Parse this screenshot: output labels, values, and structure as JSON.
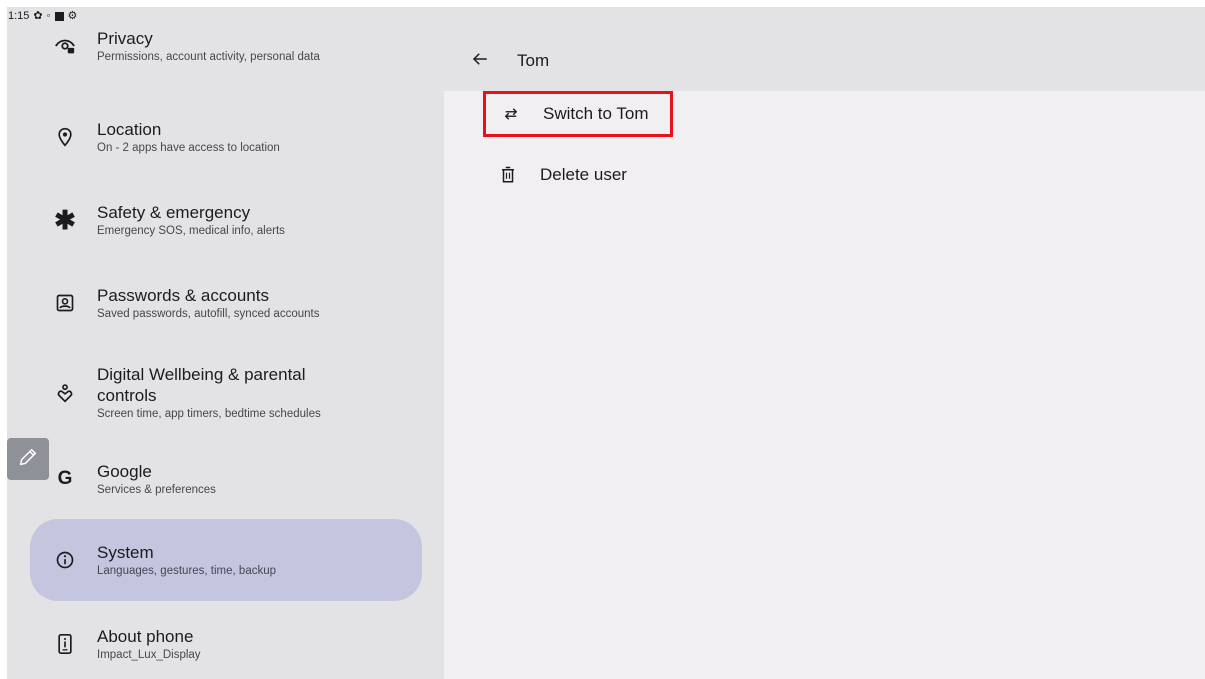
{
  "status_bar": {
    "time": "1:15",
    "icons": [
      "settings-gear-icon",
      "dot-icon",
      "square-icon",
      "android-icon"
    ],
    "right_indicator": "‹·›"
  },
  "settings_menu": {
    "items": [
      {
        "title": "Privacy",
        "subtitle": "Permissions, account activity, personal data",
        "icon": "privacy-eye-icon"
      },
      {
        "title": "Location",
        "subtitle": "On - 2 apps have access to location",
        "icon": "location-pin-icon"
      },
      {
        "title": "Safety & emergency",
        "subtitle": "Emergency SOS, medical info, alerts",
        "icon": "asterisk-icon"
      },
      {
        "title": "Passwords & accounts",
        "subtitle": "Saved passwords, autofill, synced accounts",
        "icon": "account-box-icon"
      },
      {
        "title": "Digital Wellbeing & parental controls",
        "title_line1": "Digital Wellbeing & parental",
        "title_line2": "controls",
        "subtitle": "Screen time, app timers, bedtime schedules",
        "icon": "wellbeing-icon"
      },
      {
        "title": "Google",
        "subtitle": "Services & preferences",
        "icon": "google-g-icon"
      },
      {
        "title": "System",
        "subtitle": "Languages, gestures, time, backup",
        "icon": "info-icon",
        "selected": true
      },
      {
        "title": "About phone",
        "subtitle": "Impact_Lux_Display",
        "icon": "phone-icon"
      }
    ]
  },
  "detail": {
    "title": "Tom",
    "actions": [
      {
        "label": "Switch to Tom",
        "icon": "switch-arrows-icon",
        "highlighted": true
      },
      {
        "label": "Delete user",
        "icon": "trash-icon"
      }
    ]
  },
  "colors": {
    "left_panel": "#e3e2e5",
    "right_panel": "#f1eff2",
    "selected_item": "#c4c6df",
    "highlight_border": "#e8111a"
  }
}
